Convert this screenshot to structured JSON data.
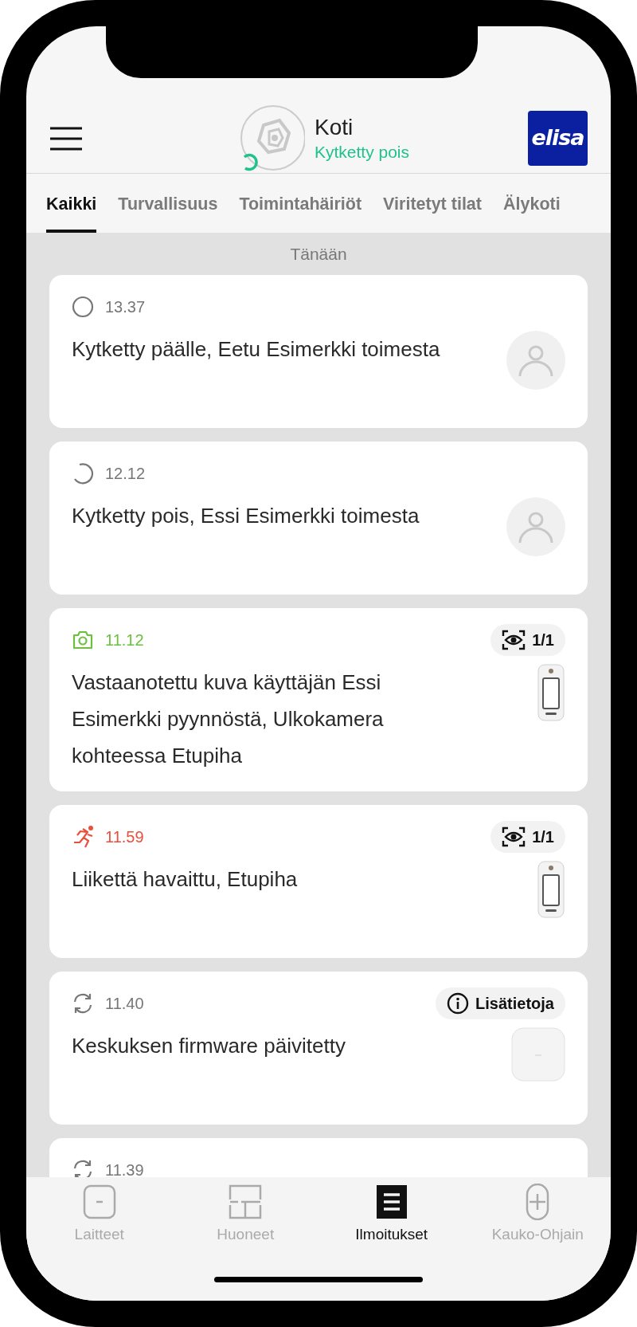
{
  "header": {
    "title": "Koti",
    "status": "Kytketty pois",
    "brand": "elisa"
  },
  "tabs": [
    {
      "label": "Kaikki",
      "selected": true
    },
    {
      "label": "Turvallisuus",
      "selected": false
    },
    {
      "label": "Toimintahäiriöt",
      "selected": false
    },
    {
      "label": "Viritetyt tilat",
      "selected": false
    },
    {
      "label": "Älykoti",
      "selected": false
    }
  ],
  "section_label": "Tänään",
  "events": [
    {
      "kind": "armed",
      "time": "13.37",
      "color": "#777777",
      "message": "Kytketty päälle, Eetu Esimerkki toimesta",
      "thumb": {
        "kind": "avatar"
      }
    },
    {
      "kind": "disarmed",
      "time": "12.12",
      "color": "#777777",
      "message": "Kytketty pois, Essi Esimerkki toimesta",
      "thumb": {
        "kind": "avatar"
      }
    },
    {
      "kind": "photo",
      "time": "11.12",
      "color": "#6cbf3f",
      "message": "Vastaanotettu kuva käyttäjän Essi Esimerkki pyynnöstä, Ulkokamera kohteessa Etupiha",
      "thumb": {
        "kind": "camera"
      },
      "badge": {
        "kind": "views",
        "label": "1/1"
      }
    },
    {
      "kind": "motion",
      "time": "11.59",
      "color": "#e8503e",
      "message": "Liikettä havaittu, Etupiha",
      "thumb": {
        "kind": "camera"
      },
      "badge": {
        "kind": "views",
        "label": "1/1"
      }
    },
    {
      "kind": "update",
      "time": "11.40",
      "color": "#777777",
      "message": "Keskuksen firmware päivitetty",
      "thumb": {
        "kind": "hub"
      },
      "badge": {
        "kind": "info",
        "label": "Lisätietoja"
      }
    },
    {
      "kind": "update",
      "time": "11.39",
      "color": "#777777"
    }
  ],
  "bottom_nav": [
    {
      "label": "Laitteet",
      "kind": "devices",
      "selected": false
    },
    {
      "label": "Huoneet",
      "kind": "rooms",
      "selected": false
    },
    {
      "label": "Ilmoitukset",
      "kind": "notifications",
      "selected": true
    },
    {
      "label": "Kauko-Ohjain",
      "kind": "remote",
      "selected": false
    }
  ]
}
